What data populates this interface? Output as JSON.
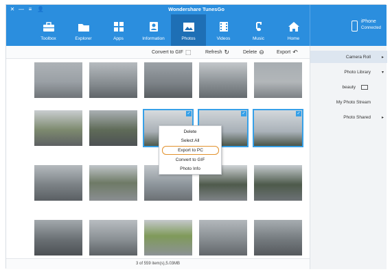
{
  "app": {
    "title": "Wondershare TunesGo"
  },
  "window_controls": {
    "close": "✕",
    "minimize": "—",
    "menu": "≡",
    "user": "👤"
  },
  "nav": {
    "items": [
      {
        "label": "Toolbox",
        "icon": "toolbox-icon"
      },
      {
        "label": "Explorer",
        "icon": "folder-icon"
      },
      {
        "label": "Apps",
        "icon": "apps-icon"
      },
      {
        "label": "Information",
        "icon": "contacts-icon"
      },
      {
        "label": "Photos",
        "icon": "photos-icon",
        "active": true
      },
      {
        "label": "Videos",
        "icon": "film-icon"
      },
      {
        "label": "Music",
        "icon": "music-note-icon"
      },
      {
        "label": "Home",
        "icon": "home-icon"
      }
    ]
  },
  "device": {
    "name": "iPhone",
    "status": "Connected"
  },
  "toolbar": {
    "gif_label": "Convert to GIF",
    "refresh_label": "Refresh",
    "delete_label": "Delete",
    "export_label": "Export"
  },
  "sidebar": {
    "items": [
      {
        "label": "Camera Roll",
        "arrow": "▸",
        "active": true
      },
      {
        "label": "Photo Library",
        "arrow": "▾"
      },
      {
        "label": "beauty"
      },
      {
        "label": "My Photo Stream"
      },
      {
        "label": "Photo Shared",
        "arrow": "▸"
      }
    ]
  },
  "context_menu": {
    "items": [
      {
        "label": "Delete"
      },
      {
        "label": "Select All"
      },
      {
        "label": "Export to PC",
        "highlight": true
      },
      {
        "label": "Convert to GIF"
      },
      {
        "label": "Photo Info"
      }
    ]
  },
  "status": {
    "text": "3 of 559 item(s),5.03MB"
  },
  "colors": {
    "accent": "#2b8ede",
    "accent_dark": "#1e6fb5",
    "selection": "#36a0e8",
    "highlight_outline": "#e2902a"
  }
}
